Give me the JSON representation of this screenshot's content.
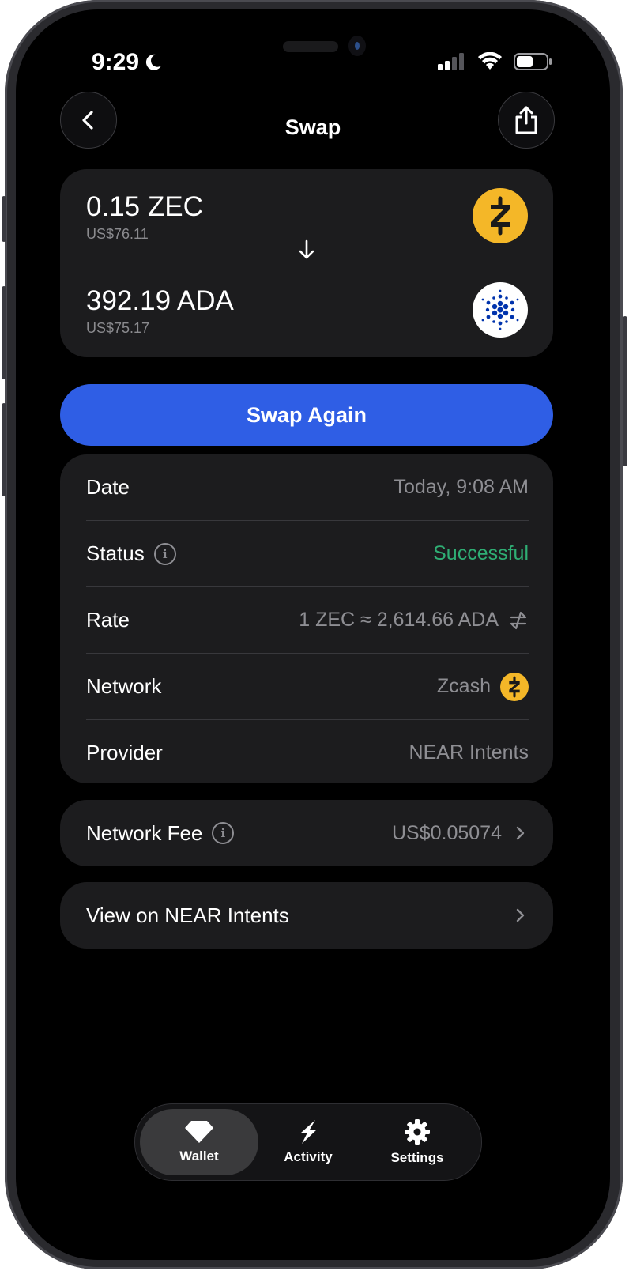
{
  "status_bar": {
    "time": "9:29"
  },
  "header": {
    "title": "Swap"
  },
  "swap": {
    "from": {
      "amount": "0.15 ZEC",
      "usd": "US$76.11"
    },
    "to": {
      "amount": "392.19 ADA",
      "usd": "US$75.17"
    }
  },
  "swap_again_label": "Swap Again",
  "details": {
    "date_label": "Date",
    "date_value": "Today, 9:08 AM",
    "status_label": "Status",
    "status_value": "Successful",
    "rate_label": "Rate",
    "rate_value": "1 ZEC ≈ 2,614.66 ADA",
    "network_label": "Network",
    "network_value": "Zcash",
    "provider_label": "Provider",
    "provider_value": "NEAR Intents"
  },
  "fee": {
    "label": "Network Fee",
    "value": "US$0.05074"
  },
  "explorer_link": {
    "label": "View on NEAR Intents"
  },
  "tabbar": {
    "wallet": "Wallet",
    "activity": "Activity",
    "settings": "Settings"
  },
  "colors": {
    "accent": "#2f5ee5",
    "success": "#2fae74",
    "zcash": "#f4b728",
    "cardano": "#0033ad"
  }
}
